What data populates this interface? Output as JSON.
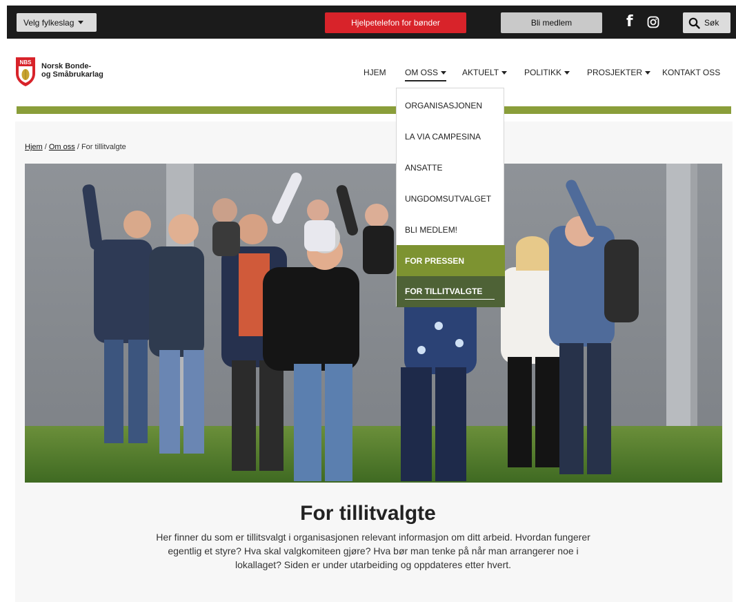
{
  "topbar": {
    "fylkeslag_label": "Velg fylkeslag",
    "hjelpetelefon_label": "Hjelpetelefon for bønder",
    "bli_medlem_label": "Bli medlem",
    "facebook_icon": "facebook-icon",
    "instagram_icon": "instagram-icon",
    "search_label": "Søk",
    "colors": {
      "bar": "#1b1b1b",
      "hjelpetelefon": "#d8232a",
      "button_grey": "#c9c9c9"
    }
  },
  "header": {
    "logo_initials": "NBS",
    "org_name_line1": "Norsk Bonde-",
    "org_name_line2": "og Småbrukarlag",
    "nav": [
      {
        "label": "HJEM",
        "has_caret": false,
        "active": false
      },
      {
        "label": "OM OSS",
        "has_caret": true,
        "active": true
      },
      {
        "label": "AKTUELT",
        "has_caret": true,
        "active": false
      },
      {
        "label": "POLITIKK",
        "has_caret": true,
        "active": false
      },
      {
        "label": "PROSJEKTER",
        "has_caret": true,
        "active": false
      },
      {
        "label": "KONTAKT OSS",
        "has_caret": false,
        "active": false
      }
    ],
    "accent_color": "#8a9e3a"
  },
  "dropdown": {
    "items": [
      {
        "label": "ORGANISASJONEN"
      },
      {
        "label": "LA VIA CAMPESINA"
      },
      {
        "label": "ANSATTE"
      },
      {
        "label": "UNGDOMSUTVALGET"
      },
      {
        "label": "BLI MEDLEM!"
      },
      {
        "label": "FOR PRESSEN",
        "highlight": "#7d9331"
      },
      {
        "label": "FOR TILLITVALGTE",
        "highlight": "#4e6236",
        "current": true
      }
    ]
  },
  "breadcrumb": {
    "items": [
      "Hjem",
      "Om oss",
      "For tillitvalgte"
    ],
    "separator": "/"
  },
  "main": {
    "title": "For tillitvalgte",
    "intro": "Her finner du som er tillitsvalgt i organisasjonen relevant informasjon om ditt arbeid. Hvordan fungerer egentlig et styre? Hva skal valgkomiteen gjøre? Hva bør man tenke på når man arrangerer noe i lokallaget? Siden er under utarbeiding og oppdateres etter hvert."
  }
}
